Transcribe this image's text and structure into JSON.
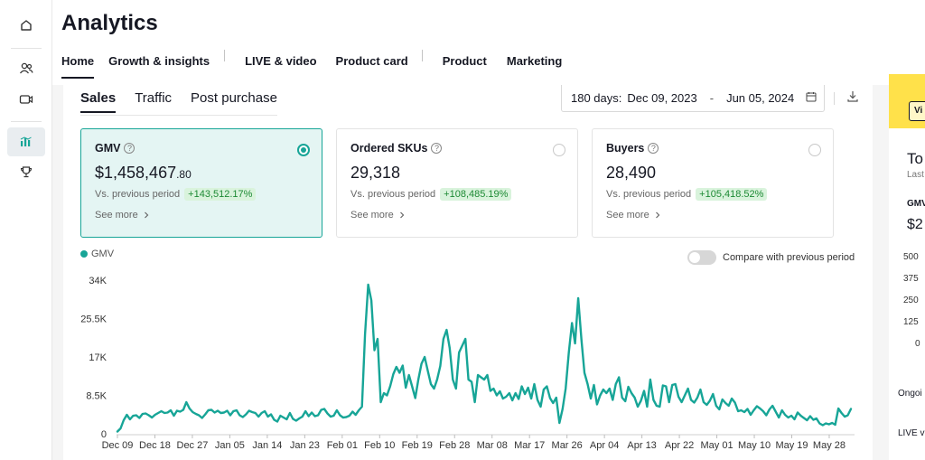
{
  "header": {
    "title": "Analytics",
    "nav": [
      "Home",
      "Growth & insights",
      "LIVE & video",
      "Product card",
      "Product",
      "Marketing"
    ]
  },
  "subtabs": [
    "Sales",
    "Traffic",
    "Post purchase"
  ],
  "date_range": {
    "label": "180 days:",
    "start": "Dec 09, 2023",
    "separator": "-",
    "end": "Jun 05, 2024"
  },
  "metrics": [
    {
      "name": "GMV",
      "value_main": "$1,458,467",
      "value_small": ".80",
      "compare_label": "Vs. previous period",
      "change": "+143,512.17%",
      "see_more": "See more",
      "selected": true
    },
    {
      "name": "Ordered SKUs",
      "value_main": "29,318",
      "value_small": "",
      "compare_label": "Vs. previous period",
      "change": "+108,485.19%",
      "see_more": "See more",
      "selected": false
    },
    {
      "name": "Buyers",
      "value_main": "28,490",
      "value_small": "",
      "compare_label": "Vs. previous period",
      "change": "+105,418.52%",
      "see_more": "See more",
      "selected": false
    }
  ],
  "legend_label": "GMV",
  "compare_toggle_label": "Compare with previous period",
  "chart_data": {
    "type": "line",
    "series": [
      {
        "name": "GMV",
        "color": "#17a597",
        "values": [
          500,
          1200,
          3000,
          4200,
          3200,
          4000,
          4100,
          3500,
          4400,
          4500,
          4100,
          3600,
          4200,
          4600,
          5000,
          4600,
          4700,
          5200,
          4000,
          5100,
          4900,
          5300,
          7000,
          5600,
          4800,
          4400,
          4100,
          3500,
          4300,
          5200,
          5300,
          4700,
          5100,
          4600,
          4700,
          5100,
          4100,
          5000,
          5200,
          4100,
          3700,
          4300,
          5100,
          4800,
          4600,
          3800,
          4600,
          5000,
          3800,
          4300,
          3100,
          2700,
          4000,
          3600,
          3200,
          4600,
          3300,
          2900,
          3400,
          3800,
          5000,
          3900,
          4700,
          3900,
          4100,
          5300,
          5500,
          4500,
          3800,
          4000,
          5200,
          4100,
          3600,
          3700,
          4000,
          4900,
          4200,
          5200,
          6000,
          22000,
          33000,
          29500,
          18500,
          21000,
          7000,
          9000,
          8500,
          10500,
          13200,
          14800,
          13500,
          15100,
          10200,
          13000,
          10500,
          7900,
          12000,
          15500,
          17000,
          14000,
          11000,
          10000,
          12000,
          15000,
          21000,
          23000,
          19000,
          12000,
          10000,
          18000,
          19500,
          21000,
          12000,
          11500,
          7000,
          13000,
          12500,
          12000,
          13000,
          9500,
          10000,
          8500,
          9400,
          7800,
          8200,
          9000,
          7400,
          9000,
          7700,
          10500,
          8800,
          10200,
          7800,
          11000,
          7500,
          6000,
          9800,
          10500,
          7900,
          6800,
          8000,
          2400,
          5500,
          10000,
          18000,
          24500,
          20000,
          30000,
          21000,
          13500,
          11000,
          7800,
          10800,
          6500,
          8500,
          9800,
          9000,
          10000,
          7500,
          11000,
          12500,
          8000,
          7200,
          10400,
          9000,
          8000,
          6000,
          7300,
          9500,
          6000,
          12000,
          7500,
          6200,
          6000,
          10700,
          10500,
          7000,
          10800,
          11000,
          8200,
          7000,
          8500,
          10000,
          7500,
          6900,
          8000,
          9800,
          7000,
          6400,
          7300,
          8800,
          6200,
          5400,
          7600,
          6800,
          6200,
          7800,
          6900,
          5000,
          5200,
          4800,
          5500,
          4200,
          5200,
          6100,
          5600,
          5000,
          4100,
          5400,
          6200,
          4900,
          3600,
          5200,
          4200,
          3600,
          4000,
          3200,
          4700,
          4000,
          3500,
          3000,
          3900,
          3100,
          3400,
          2300,
          1900,
          2300,
          2100,
          2400,
          2000,
          5600,
          4600,
          3800,
          4100,
          5500
        ]
      }
    ],
    "x_tick_labels": [
      "Dec 09",
      "Dec 18",
      "Dec 27",
      "Jan 05",
      "Jan 14",
      "Jan 23",
      "Feb 01",
      "Feb 10",
      "Feb 19",
      "Feb 28",
      "Mar 08",
      "Mar 17",
      "Mar 26",
      "Apr 04",
      "Apr 13",
      "Apr 22",
      "May 01",
      "May 10",
      "May 19",
      "May 28"
    ],
    "y_ticks": [
      0,
      8500,
      17000,
      25500,
      34000
    ],
    "y_tick_labels": [
      "0",
      "8.5K",
      "17K",
      "25.5K",
      "34K"
    ],
    "ylim": [
      0,
      34000
    ],
    "grid": "vertical-tick-marks"
  },
  "right_panel": {
    "view_label": "Vi",
    "title_fragment": "To",
    "subtitle_fragment": "Last",
    "metric_fragment": "GMV",
    "value_fragment": "$2",
    "y_ticks": [
      "500",
      "375",
      "250",
      "125",
      "0"
    ],
    "footer_1": "Ongoi",
    "footer_2": "LIVE v"
  }
}
